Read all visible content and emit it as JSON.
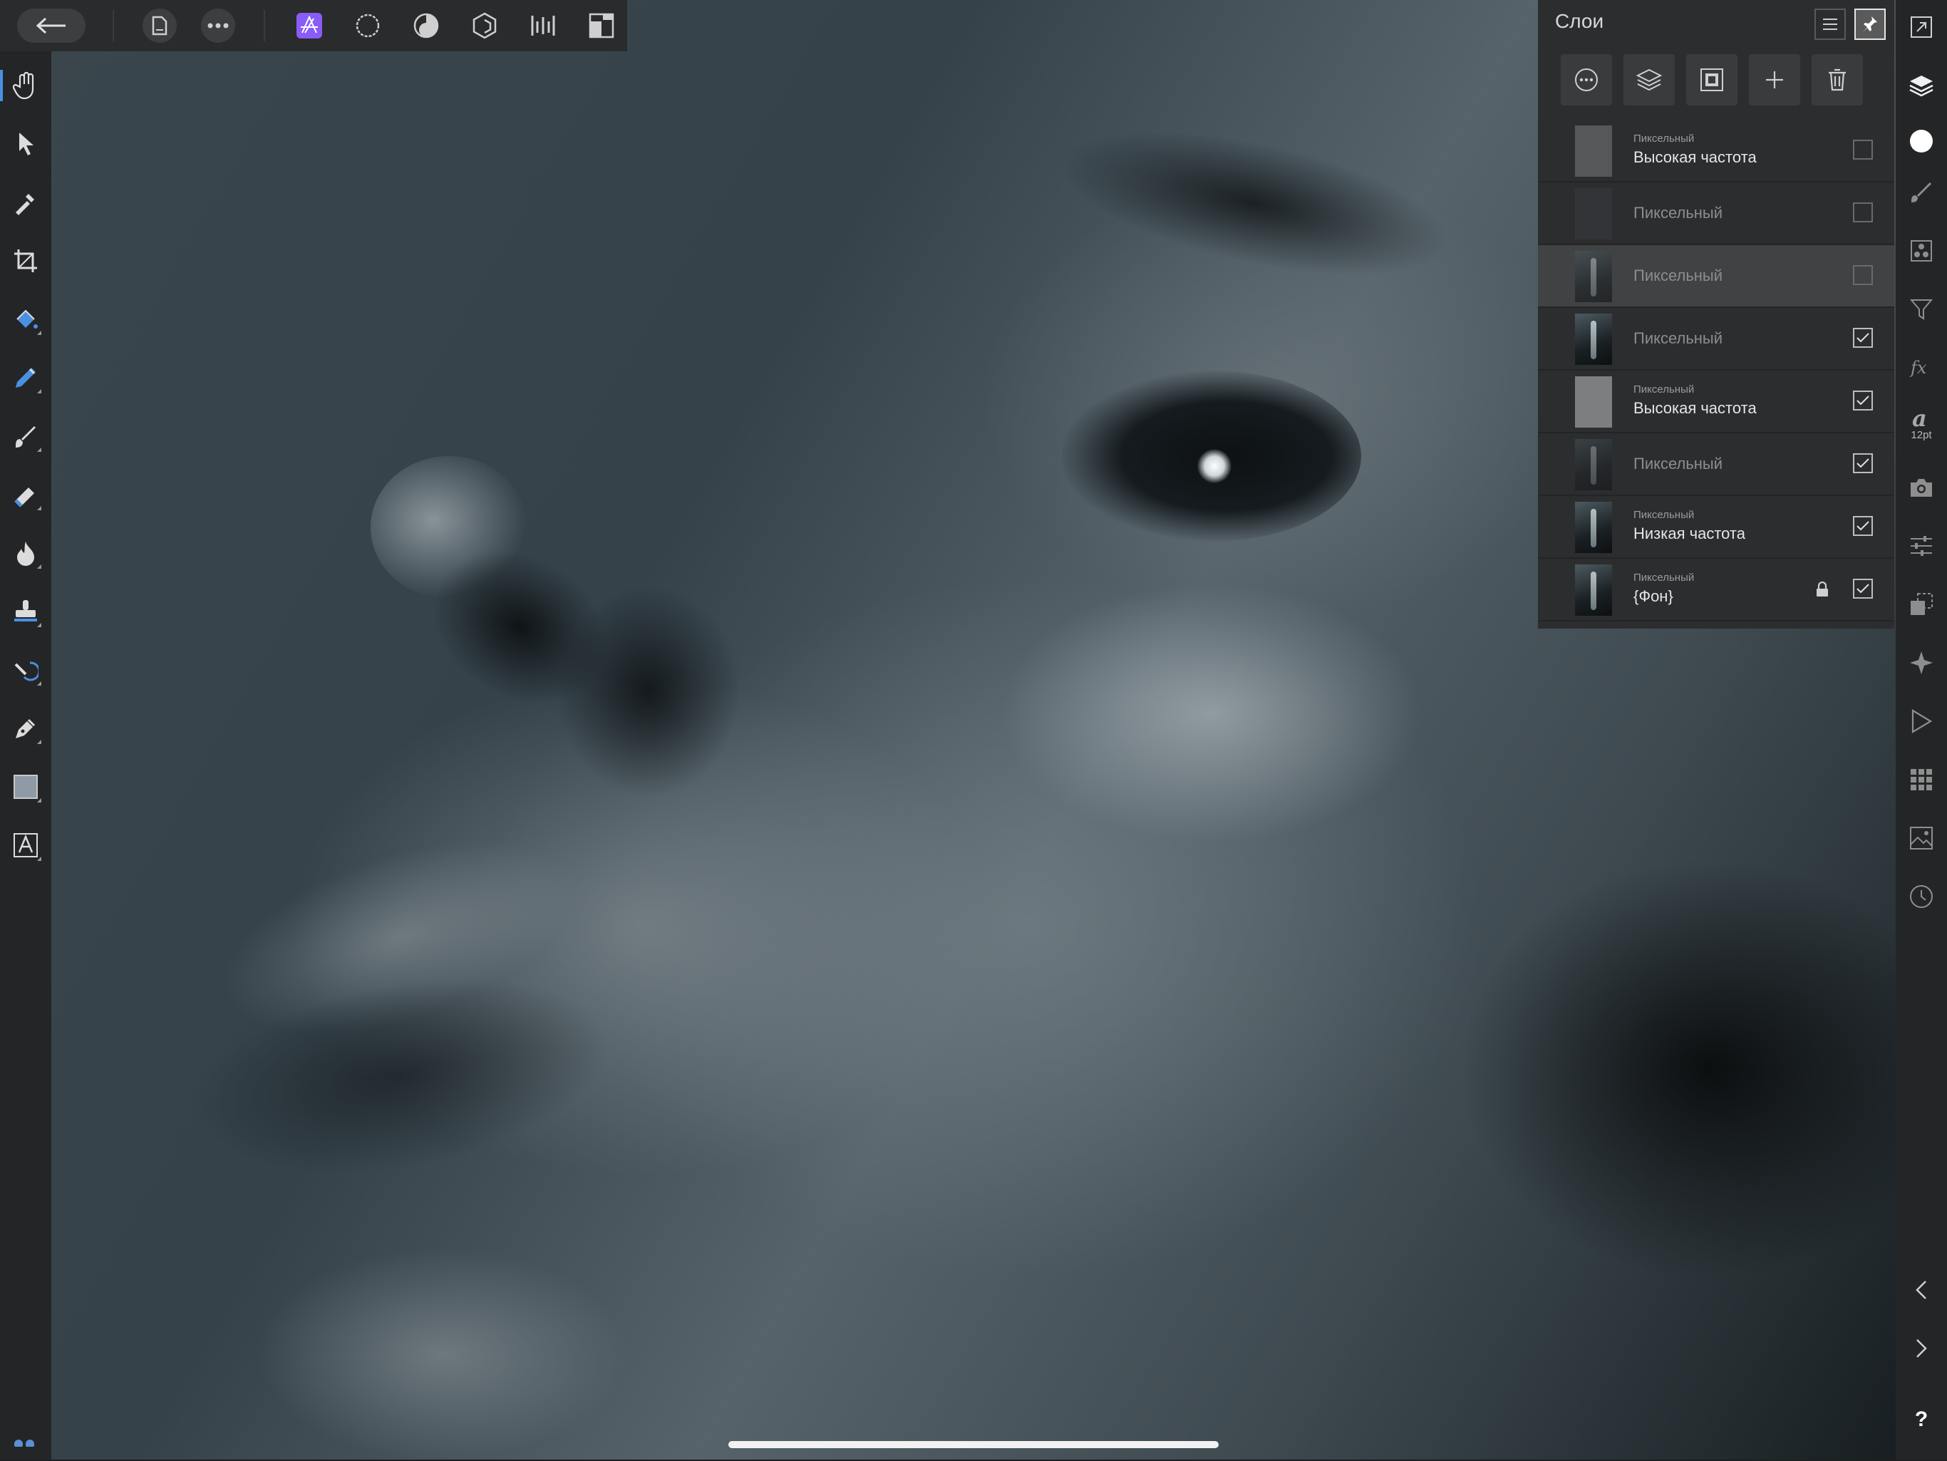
{
  "colors": {
    "accent_blue": "#4a90e2",
    "persona_purple": "#8a5cf6",
    "panel_bg": "#2c2d2f",
    "toolbar_bg": "#2a2b2d"
  },
  "toolbar": {
    "back_icon": "arrow-left-icon",
    "document_icon": "document-icon",
    "more_icon": "ellipsis-icon",
    "personas": [
      "photo-persona-icon",
      "liquify-persona-icon",
      "develop-persona-icon",
      "tone-mapping-persona-icon",
      "export-persona-icon",
      "arrange-icon"
    ]
  },
  "tools": [
    "hand-tool-icon",
    "move-tool-icon",
    "color-picker-tool-icon",
    "crop-tool-icon",
    "flood-fill-tool-icon",
    "selection-brush-tool-icon",
    "paint-brush-tool-icon",
    "erase-brush-tool-icon",
    "dodge-burn-tool-icon",
    "clone-tool-icon",
    "inpainting-tool-icon",
    "pen-tool-icon",
    "rectangle-tool-icon",
    "text-tool-icon"
  ],
  "layers": {
    "title": "Слои",
    "items": [
      {
        "type": "Пиксельный",
        "name": "Высокая частота",
        "visible": false,
        "selected": false,
        "locked": false
      },
      {
        "type": "",
        "name": "Пиксельный",
        "visible": false,
        "selected": false,
        "locked": false
      },
      {
        "type": "",
        "name": "Пиксельный",
        "visible": false,
        "selected": true,
        "locked": false
      },
      {
        "type": "",
        "name": "Пиксельный",
        "visible": true,
        "selected": false,
        "locked": false
      },
      {
        "type": "Пиксельный",
        "name": "Высокая частота",
        "visible": true,
        "selected": false,
        "locked": false
      },
      {
        "type": "",
        "name": "Пиксельный",
        "visible": true,
        "selected": false,
        "locked": false
      },
      {
        "type": "Пиксельный",
        "name": "Низкая частота",
        "visible": true,
        "selected": false,
        "locked": false
      },
      {
        "type": "Пиксельный",
        "name": "{Фон}",
        "visible": true,
        "selected": false,
        "locked": true
      }
    ]
  },
  "studio": {
    "font_size_label": "12pt",
    "help_label": "?"
  }
}
